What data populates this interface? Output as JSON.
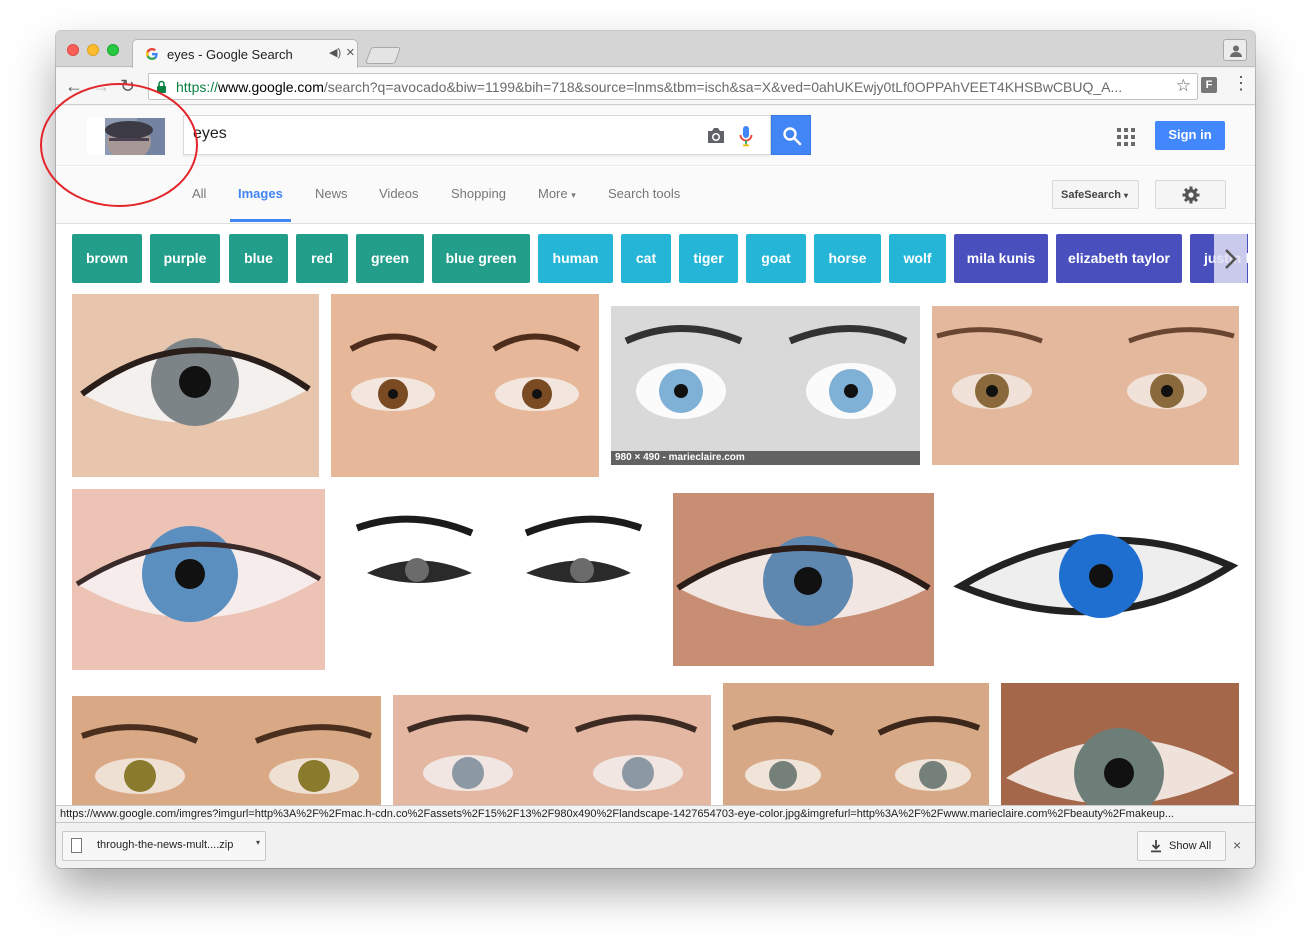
{
  "browser": {
    "tab_title": "eyes - Google Search",
    "url_scheme": "https://",
    "url_host": "www.google.com",
    "url_rest": "/search?q=avocado&biw=1199&bih=718&source=lnms&tbm=isch&sa=X&ved=0ahUKEwjy0tLf0OPPAhVEET4KHSBwCBUQ_A...",
    "extension_label": "F",
    "nav_back": "←",
    "nav_forward": "→",
    "nav_reload": "↻",
    "star_icon": "☆",
    "menu_icon": "⋮",
    "tab_audio_icon": "◀)",
    "tab_close_icon": "×"
  },
  "search": {
    "query": "eyes",
    "signin_label": "Sign in"
  },
  "nav": {
    "items": [
      {
        "label": "All"
      },
      {
        "label": "Images"
      },
      {
        "label": "News"
      },
      {
        "label": "Videos"
      },
      {
        "label": "Shopping"
      },
      {
        "label": "More"
      },
      {
        "label": "Search tools"
      }
    ],
    "more_caret": "▾",
    "safesearch_label": "SafeSearch",
    "safesearch_caret": "▾"
  },
  "chips": [
    {
      "label": "brown",
      "color": "#239e8b"
    },
    {
      "label": "purple",
      "color": "#239e8b"
    },
    {
      "label": "blue",
      "color": "#239e8b"
    },
    {
      "label": "red",
      "color": "#239e8b"
    },
    {
      "label": "green",
      "color": "#239e8b"
    },
    {
      "label": "blue green",
      "color": "#239e8b"
    },
    {
      "label": "human",
      "color": "#25b5d6"
    },
    {
      "label": "cat",
      "color": "#25b5d6"
    },
    {
      "label": "tiger",
      "color": "#25b5d6"
    },
    {
      "label": "goat",
      "color": "#25b5d6"
    },
    {
      "label": "horse",
      "color": "#25b5d6"
    },
    {
      "label": "wolf",
      "color": "#25b5d6"
    },
    {
      "label": "mila kunis",
      "color": "#4a4fbe"
    },
    {
      "label": "elizabeth taylor",
      "color": "#4a4fbe"
    },
    {
      "label": "justin b",
      "color": "#4a4fbe"
    }
  ],
  "images": [
    {
      "iris": "#7d8488"
    },
    {
      "iris": "#7a4a22"
    },
    {
      "iris": "#7fb0d6",
      "caption": "980 × 490 - marieclaire.com"
    },
    {
      "iris": "#8a6a3c"
    },
    {
      "iris": "#5b8fc0"
    },
    {
      "iris": "#6b6b6b"
    },
    {
      "iris": "#5f88b0"
    },
    {
      "iris": "#1f6fd1"
    },
    {
      "iris": "#8a7a2c"
    },
    {
      "iris": "#8c98a4"
    },
    {
      "iris": "#75807a"
    },
    {
      "iris": "#6d7e78"
    }
  ],
  "status_url": "https://www.google.com/imgres?imgurl=http%3A%2F%2Fmac.h-cdn.co%2Fassets%2F15%2F13%2F980x490%2Flandscape-1427654703-eye-color.jpg&imgrefurl=http%3A%2F%2Fwww.marieclaire.com%2Fbeauty%2Fmakeup...",
  "downloads": {
    "file_name": "through-the-news-mult....zip",
    "caret": "▾",
    "show_all_label": "Show All",
    "close_icon": "×"
  },
  "colors": {
    "google_blue": "#4285f4",
    "annotation_red": "#e2262b"
  }
}
